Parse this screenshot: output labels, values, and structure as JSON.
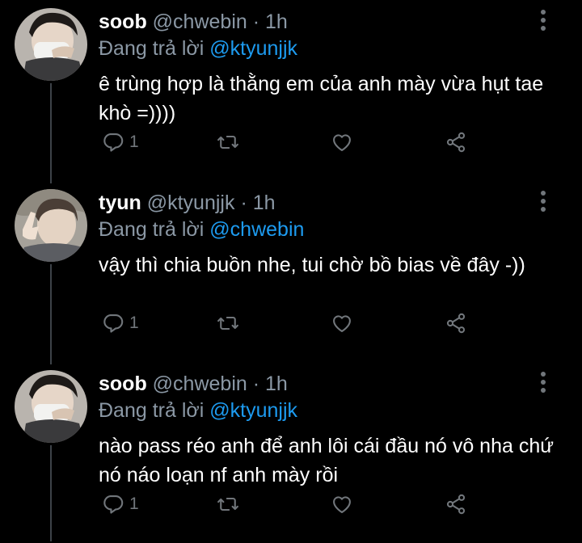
{
  "colors": {
    "background": "#000000",
    "secondary_text": "#8b98a5",
    "link": "#1d9bf0",
    "icon": "#71767b"
  },
  "tweets": [
    {
      "display_name": "soob",
      "handle": "@chwebin",
      "separator": "·",
      "time": "1h",
      "reply_prefix": "Đang trả lời",
      "reply_to": "@ktyunjjk",
      "text": "ê trùng hợp là thằng em của anh mày vừa hụt tae khò =))))",
      "reply_count": "1",
      "icons": [
        "reply-icon",
        "retweet-icon",
        "like-icon",
        "share-icon",
        "more-icon"
      ]
    },
    {
      "display_name": "tyun",
      "handle": "@ktyunjjk",
      "separator": "·",
      "time": "1h",
      "reply_prefix": "Đang trả lời",
      "reply_to": "@chwebin",
      "text": "vậy thì chia buồn nhe, tui chờ bồ bias về đây -))",
      "reply_count": "1",
      "icons": [
        "reply-icon",
        "retweet-icon",
        "like-icon",
        "share-icon",
        "more-icon"
      ]
    },
    {
      "display_name": "soob",
      "handle": "@chwebin",
      "separator": "·",
      "time": "1h",
      "reply_prefix": "Đang trả lời",
      "reply_to": "@ktyunjjk",
      "text": "nào pass réo anh để anh lôi cái đầu nó vô nha chứ nó náo loạn nf anh mày rồi",
      "reply_count": "1",
      "icons": [
        "reply-icon",
        "retweet-icon",
        "like-icon",
        "share-icon",
        "more-icon"
      ]
    }
  ]
}
